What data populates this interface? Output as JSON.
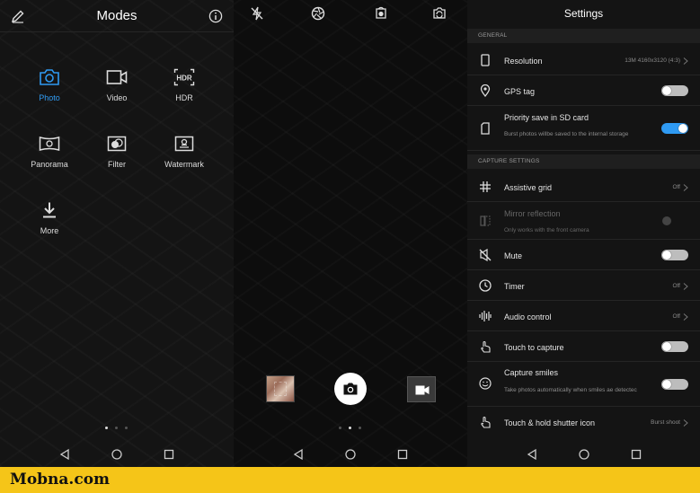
{
  "modes": {
    "title": "Modes",
    "items": [
      {
        "label": "Photo",
        "icon": "camera-icon",
        "active": true
      },
      {
        "label": "Video",
        "icon": "video-camera-icon"
      },
      {
        "label": "HDR",
        "icon": "hdr-icon",
        "glyph": "HDR"
      },
      {
        "label": "Panorama",
        "icon": "panorama-icon"
      },
      {
        "label": "Filter",
        "icon": "filter-icon"
      },
      {
        "label": "Watermark",
        "icon": "watermark-icon"
      },
      {
        "label": "More",
        "icon": "download-icon"
      }
    ]
  },
  "settings": {
    "title": "Settings",
    "sections": {
      "general": "GENERAL",
      "capture": "CAPTURE SETTINGS"
    },
    "rows": {
      "resolution": {
        "label": "Resolution",
        "value": "13M 4160x3120 (4:3)"
      },
      "gps": {
        "label": "GPS tag",
        "on": false
      },
      "sd": {
        "label": "Priority save in SD card",
        "sub": "Burst photos willbe saved to the internal storage",
        "on": true
      },
      "grid": {
        "label": "Assistive grid",
        "value": "Off"
      },
      "mirror": {
        "label": "Mirror reflection",
        "sub": "Only works with the front camera"
      },
      "mute": {
        "label": "Mute",
        "on": false
      },
      "timer": {
        "label": "Timer",
        "value": "Off"
      },
      "audio": {
        "label": "Audio control",
        "value": "Off"
      },
      "touch": {
        "label": "Touch to capture",
        "on": false
      },
      "smiles": {
        "label": "Capture smiles",
        "sub": "Take photos automatically when smiles ae detectec",
        "on": false
      },
      "hold": {
        "label": "Touch & hold shutter icon",
        "value": "Burst shoot"
      }
    }
  },
  "colors": {
    "accent": "#2f9af2",
    "brand_bar": "#f5c518"
  },
  "brand": "Mobna.com"
}
